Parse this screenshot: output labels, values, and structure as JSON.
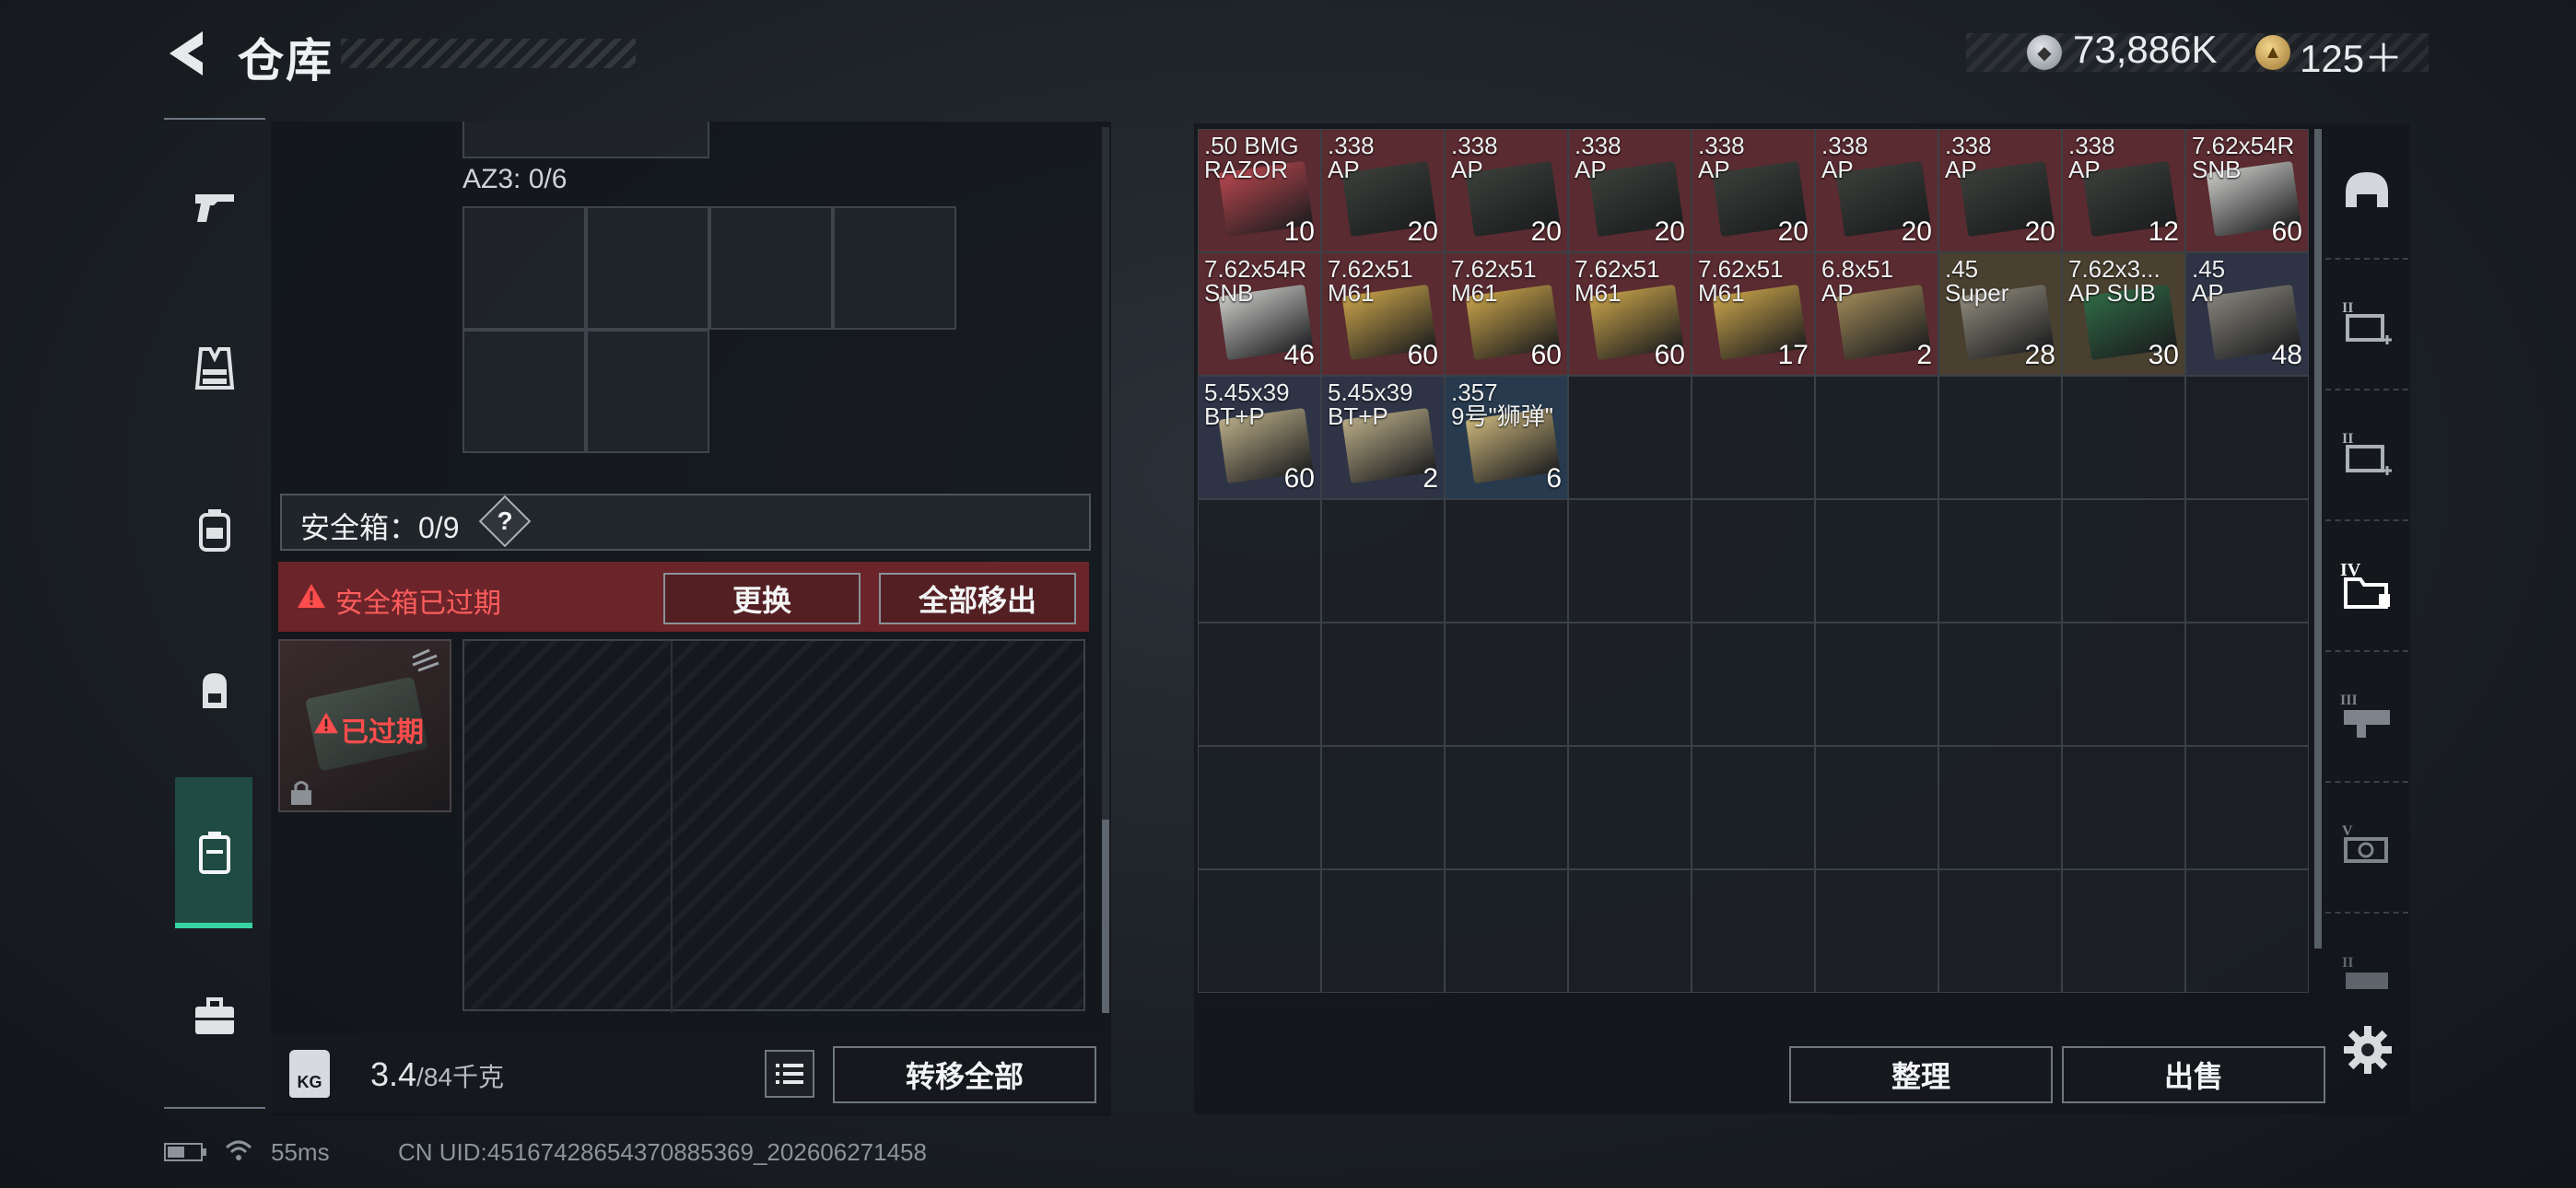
{
  "header": {
    "title": "仓库",
    "silver": "73,886K",
    "gold": "125＋"
  },
  "left_nav": [
    "pistol-icon",
    "vest-icon",
    "backpack-icon",
    "rig-icon",
    "safebox-icon",
    "briefcase-icon"
  ],
  "storage": {
    "az3_label": "AZ3: 0/6",
    "safebox_label": "安全箱：0/9",
    "help": "?",
    "expired_warning": "安全箱已过期",
    "replace_btn": "更换",
    "move_all_btn": "全部移出",
    "case_status": "已过期",
    "weight_value": "3.4",
    "weight_unit": "/84千克",
    "weight_icon": "KG",
    "transfer_all_btn": "转移全部"
  },
  "items": [
    {
      "name": ".50 BMG\nRAZOR",
      "count": "10",
      "bg": "#5a2b30",
      "box": "#b8474f"
    },
    {
      "name": ".338\nAP",
      "count": "20",
      "bg": "#5a2b30",
      "box": "#3b3f3a"
    },
    {
      "name": ".338\nAP",
      "count": "20",
      "bg": "#5a2b30",
      "box": "#3b3f3a"
    },
    {
      "name": ".338\nAP",
      "count": "20",
      "bg": "#5a2b30",
      "box": "#3b3f3a"
    },
    {
      "name": ".338\nAP",
      "count": "20",
      "bg": "#5a2b30",
      "box": "#3b3f3a"
    },
    {
      "name": ".338\nAP",
      "count": "20",
      "bg": "#5a2b30",
      "box": "#3b3f3a"
    },
    {
      "name": ".338\nAP",
      "count": "20",
      "bg": "#5a2b30",
      "box": "#3b3f3a"
    },
    {
      "name": ".338\nAP",
      "count": "12",
      "bg": "#5a2b30",
      "box": "#3b3f3a"
    },
    {
      "name": "7.62x54R\nSNB",
      "count": "60",
      "bg": "#5a2b30",
      "box": "#c9c9c6"
    },
    {
      "name": "7.62x54R\nSNB",
      "count": "46",
      "bg": "#5a2b30",
      "box": "#c9c9c6"
    },
    {
      "name": "7.62x51\nM61",
      "count": "60",
      "bg": "#5a2b30",
      "box": "#c7a24a"
    },
    {
      "name": "7.62x51\nM61",
      "count": "60",
      "bg": "#5a2b30",
      "box": "#c7a24a"
    },
    {
      "name": "7.62x51\nM61",
      "count": "60",
      "bg": "#5a2b30",
      "box": "#c7a24a"
    },
    {
      "name": "7.62x51\nM61",
      "count": "17",
      "bg": "#5a2b30",
      "box": "#c7a24a"
    },
    {
      "name": "6.8x51\nAP",
      "count": "2",
      "bg": "#5a2b30",
      "box": "#9c8757"
    },
    {
      "name": ".45\nSuper",
      "count": "28",
      "bg": "#4a4030",
      "box": "#8f8a7b"
    },
    {
      "name": "7.62x3...\nAP SUB",
      "count": "30",
      "bg": "#4a4030",
      "box": "#2f6a45"
    },
    {
      "name": ".45\nAP",
      "count": "48",
      "bg": "#2e3446",
      "box": "#86837a"
    },
    {
      "name": "5.45x39\nBT+P",
      "count": "60",
      "bg": "#2e3446",
      "box": "#b8ab86"
    },
    {
      "name": "5.45x39\nBT+P",
      "count": "2",
      "bg": "#2e3446",
      "box": "#b8ab86"
    },
    {
      "name": ".357\n9号\"狮弹\"",
      "count": "6",
      "bg": "#273a4e",
      "box": "#c9b47a"
    }
  ],
  "right_actions": {
    "sort_btn": "整理",
    "sell_btn": "出售"
  },
  "categories": [
    "helmet-icon",
    "armor-ii-icon",
    "armor-ii-alt-icon",
    "iv-container-icon",
    "iii-rig-icon",
    "v-gear-icon",
    "ii-gear-icon"
  ],
  "status": {
    "ping": "55ms",
    "uid": "CN UID:45167428654370885369_202606271458"
  },
  "colors": {
    "accent": "#38d2a0",
    "danger": "#ff4c4c",
    "expired_bg": "#6b2429"
  }
}
